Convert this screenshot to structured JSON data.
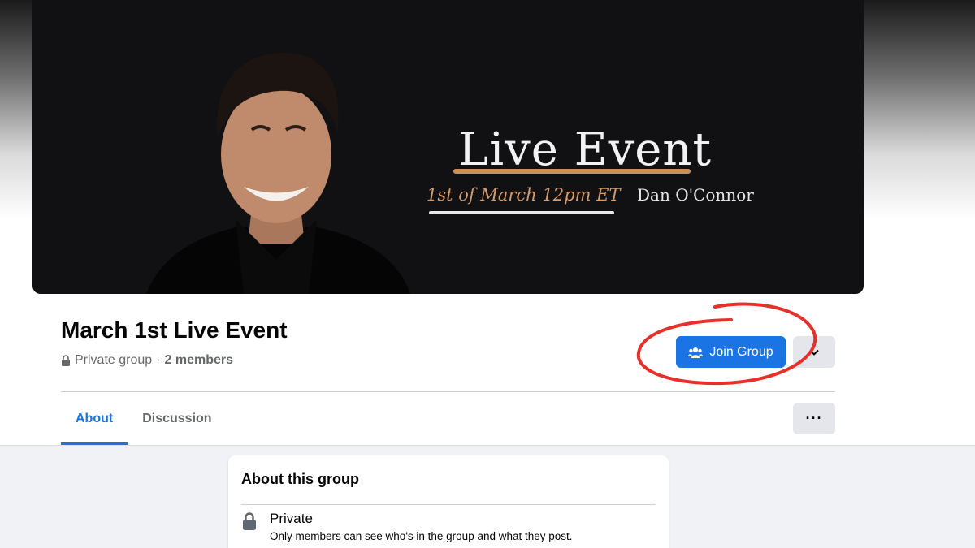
{
  "cover": {
    "title": "Live Event",
    "date": "1st of March 12pm ET",
    "host": "Dan O'Connor"
  },
  "group": {
    "name": "March 1st Live Event",
    "privacy": "Private group",
    "separator": "·",
    "members": "2 members"
  },
  "actions": {
    "join_label": "Join Group",
    "join_icon": "people-icon",
    "more_icon": "chevron-down-icon"
  },
  "tabs": [
    {
      "label": "About",
      "active": true
    },
    {
      "label": "Discussion",
      "active": false
    }
  ],
  "tab_more_label": "···",
  "about": {
    "title": "About this group",
    "privacy_title": "Private",
    "privacy_desc": "Only members can see who's in the group and what they post."
  },
  "colors": {
    "accent": "#1b74e4",
    "annotation": "#e5312b",
    "cover_bg": "#111113",
    "cover_accent": "#d39c6e"
  }
}
